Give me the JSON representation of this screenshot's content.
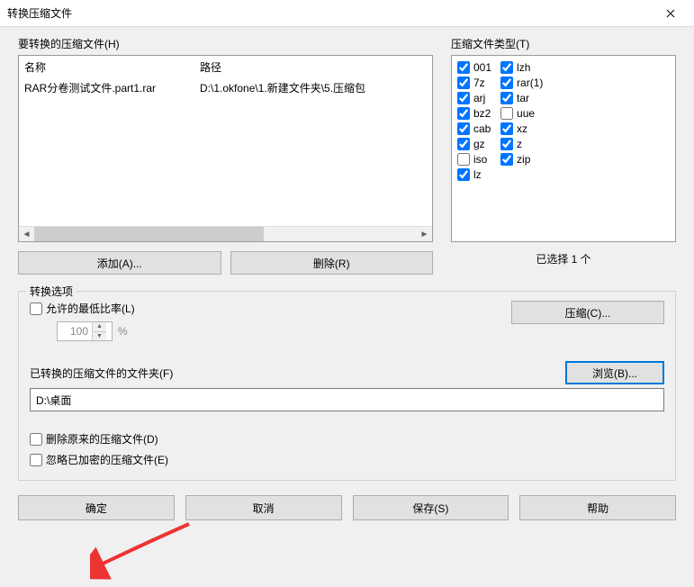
{
  "window": {
    "title": "转换压缩文件"
  },
  "archives": {
    "label": "要转换的压缩文件(H)",
    "columns": {
      "name": "名称",
      "path": "路径"
    },
    "rows": [
      {
        "name": "RAR分卷测试文件.part1.rar",
        "path": "D:\\1.okfone\\1.新建文件夹\\5.压缩包"
      }
    ],
    "buttons": {
      "add": "添加(A)...",
      "remove": "删除(R)"
    }
  },
  "types": {
    "label": "压缩文件类型(T)",
    "col1": [
      {
        "label": "001",
        "checked": true
      },
      {
        "label": "7z",
        "checked": true
      },
      {
        "label": "arj",
        "checked": true
      },
      {
        "label": "bz2",
        "checked": true
      },
      {
        "label": "cab",
        "checked": true
      },
      {
        "label": "gz",
        "checked": true
      },
      {
        "label": "iso",
        "checked": false
      },
      {
        "label": "lz",
        "checked": true
      }
    ],
    "col2": [
      {
        "label": "lzh",
        "checked": true
      },
      {
        "label": "rar(1)",
        "checked": true
      },
      {
        "label": "tar",
        "checked": true
      },
      {
        "label": "uue",
        "checked": false
      },
      {
        "label": "xz",
        "checked": true
      },
      {
        "label": "z",
        "checked": true
      },
      {
        "label": "zip",
        "checked": true
      }
    ],
    "selected_text": "已选择 1 个"
  },
  "options": {
    "group_title": "转换选项",
    "allow_ratio": {
      "label": "允许的最低比率(L)",
      "checked": false,
      "value": "100",
      "unit": "%"
    },
    "compress_btn": "压缩(C)...",
    "folder_label": "已转换的压缩文件的文件夹(F)",
    "browse_btn": "浏览(B)...",
    "folder_value": "D:\\桌面",
    "delete_original": {
      "label": "删除原来的压缩文件(D)",
      "checked": false
    },
    "ignore_encrypted": {
      "label": "忽略已加密的压缩文件(E)",
      "checked": false
    }
  },
  "footer": {
    "ok": "确定",
    "cancel": "取消",
    "save": "保存(S)",
    "help": "帮助"
  }
}
